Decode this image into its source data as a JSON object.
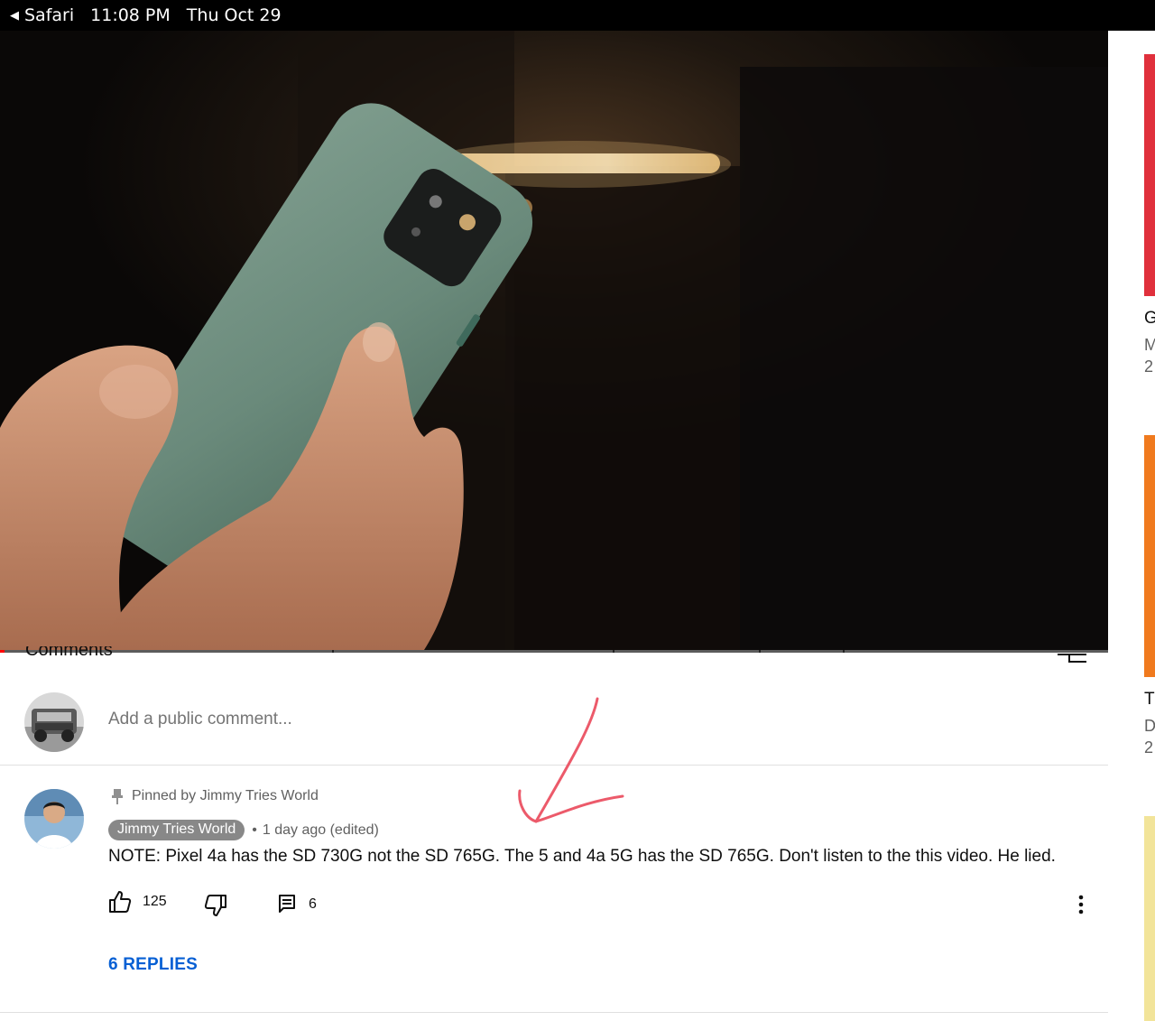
{
  "status_bar": {
    "back_app": "Safari",
    "time": "11:08 PM",
    "date": "Thu Oct 29"
  },
  "player": {
    "progress_fraction": 0.004,
    "colors": {
      "progress": "#ff0000"
    }
  },
  "comments_header": {
    "label_fragment": "Comments"
  },
  "sidebar_peek": {
    "items": [
      {
        "title_initial": "G",
        "meta_line1": "M",
        "meta_line2": "2",
        "thumb_color": "#e0303c"
      },
      {
        "title_initial": "T",
        "meta_line1": "D",
        "meta_line2": "2",
        "thumb_color": "#f07a1e"
      },
      {
        "thumb_color": "#f2e49a"
      }
    ]
  },
  "add_comment": {
    "placeholder": "Add a public comment..."
  },
  "pinned_comment": {
    "pinned_label": "Pinned by Jimmy Tries World",
    "author": "Jimmy Tries World",
    "separator": "•",
    "timestamp": "1 day ago (edited)",
    "text": "NOTE: Pixel 4a has the SD 730G not the SD 765G. The 5 and 4a 5G has the SD 765G. Don't listen to the this video. He lied.",
    "like_count": "125",
    "reply_count": "6",
    "replies_link": "6 REPLIES"
  },
  "icons": {
    "pin": "pin-icon",
    "like": "thumbs-up-icon",
    "dislike": "thumbs-down-icon",
    "reply": "comment-icon",
    "more": "more-vertical-icon",
    "sort": "sort-icon",
    "back": "back-caret-icon"
  },
  "colors": {
    "link": "#065fd4",
    "annotation": "#ec5a6a",
    "chip": "#888888"
  }
}
